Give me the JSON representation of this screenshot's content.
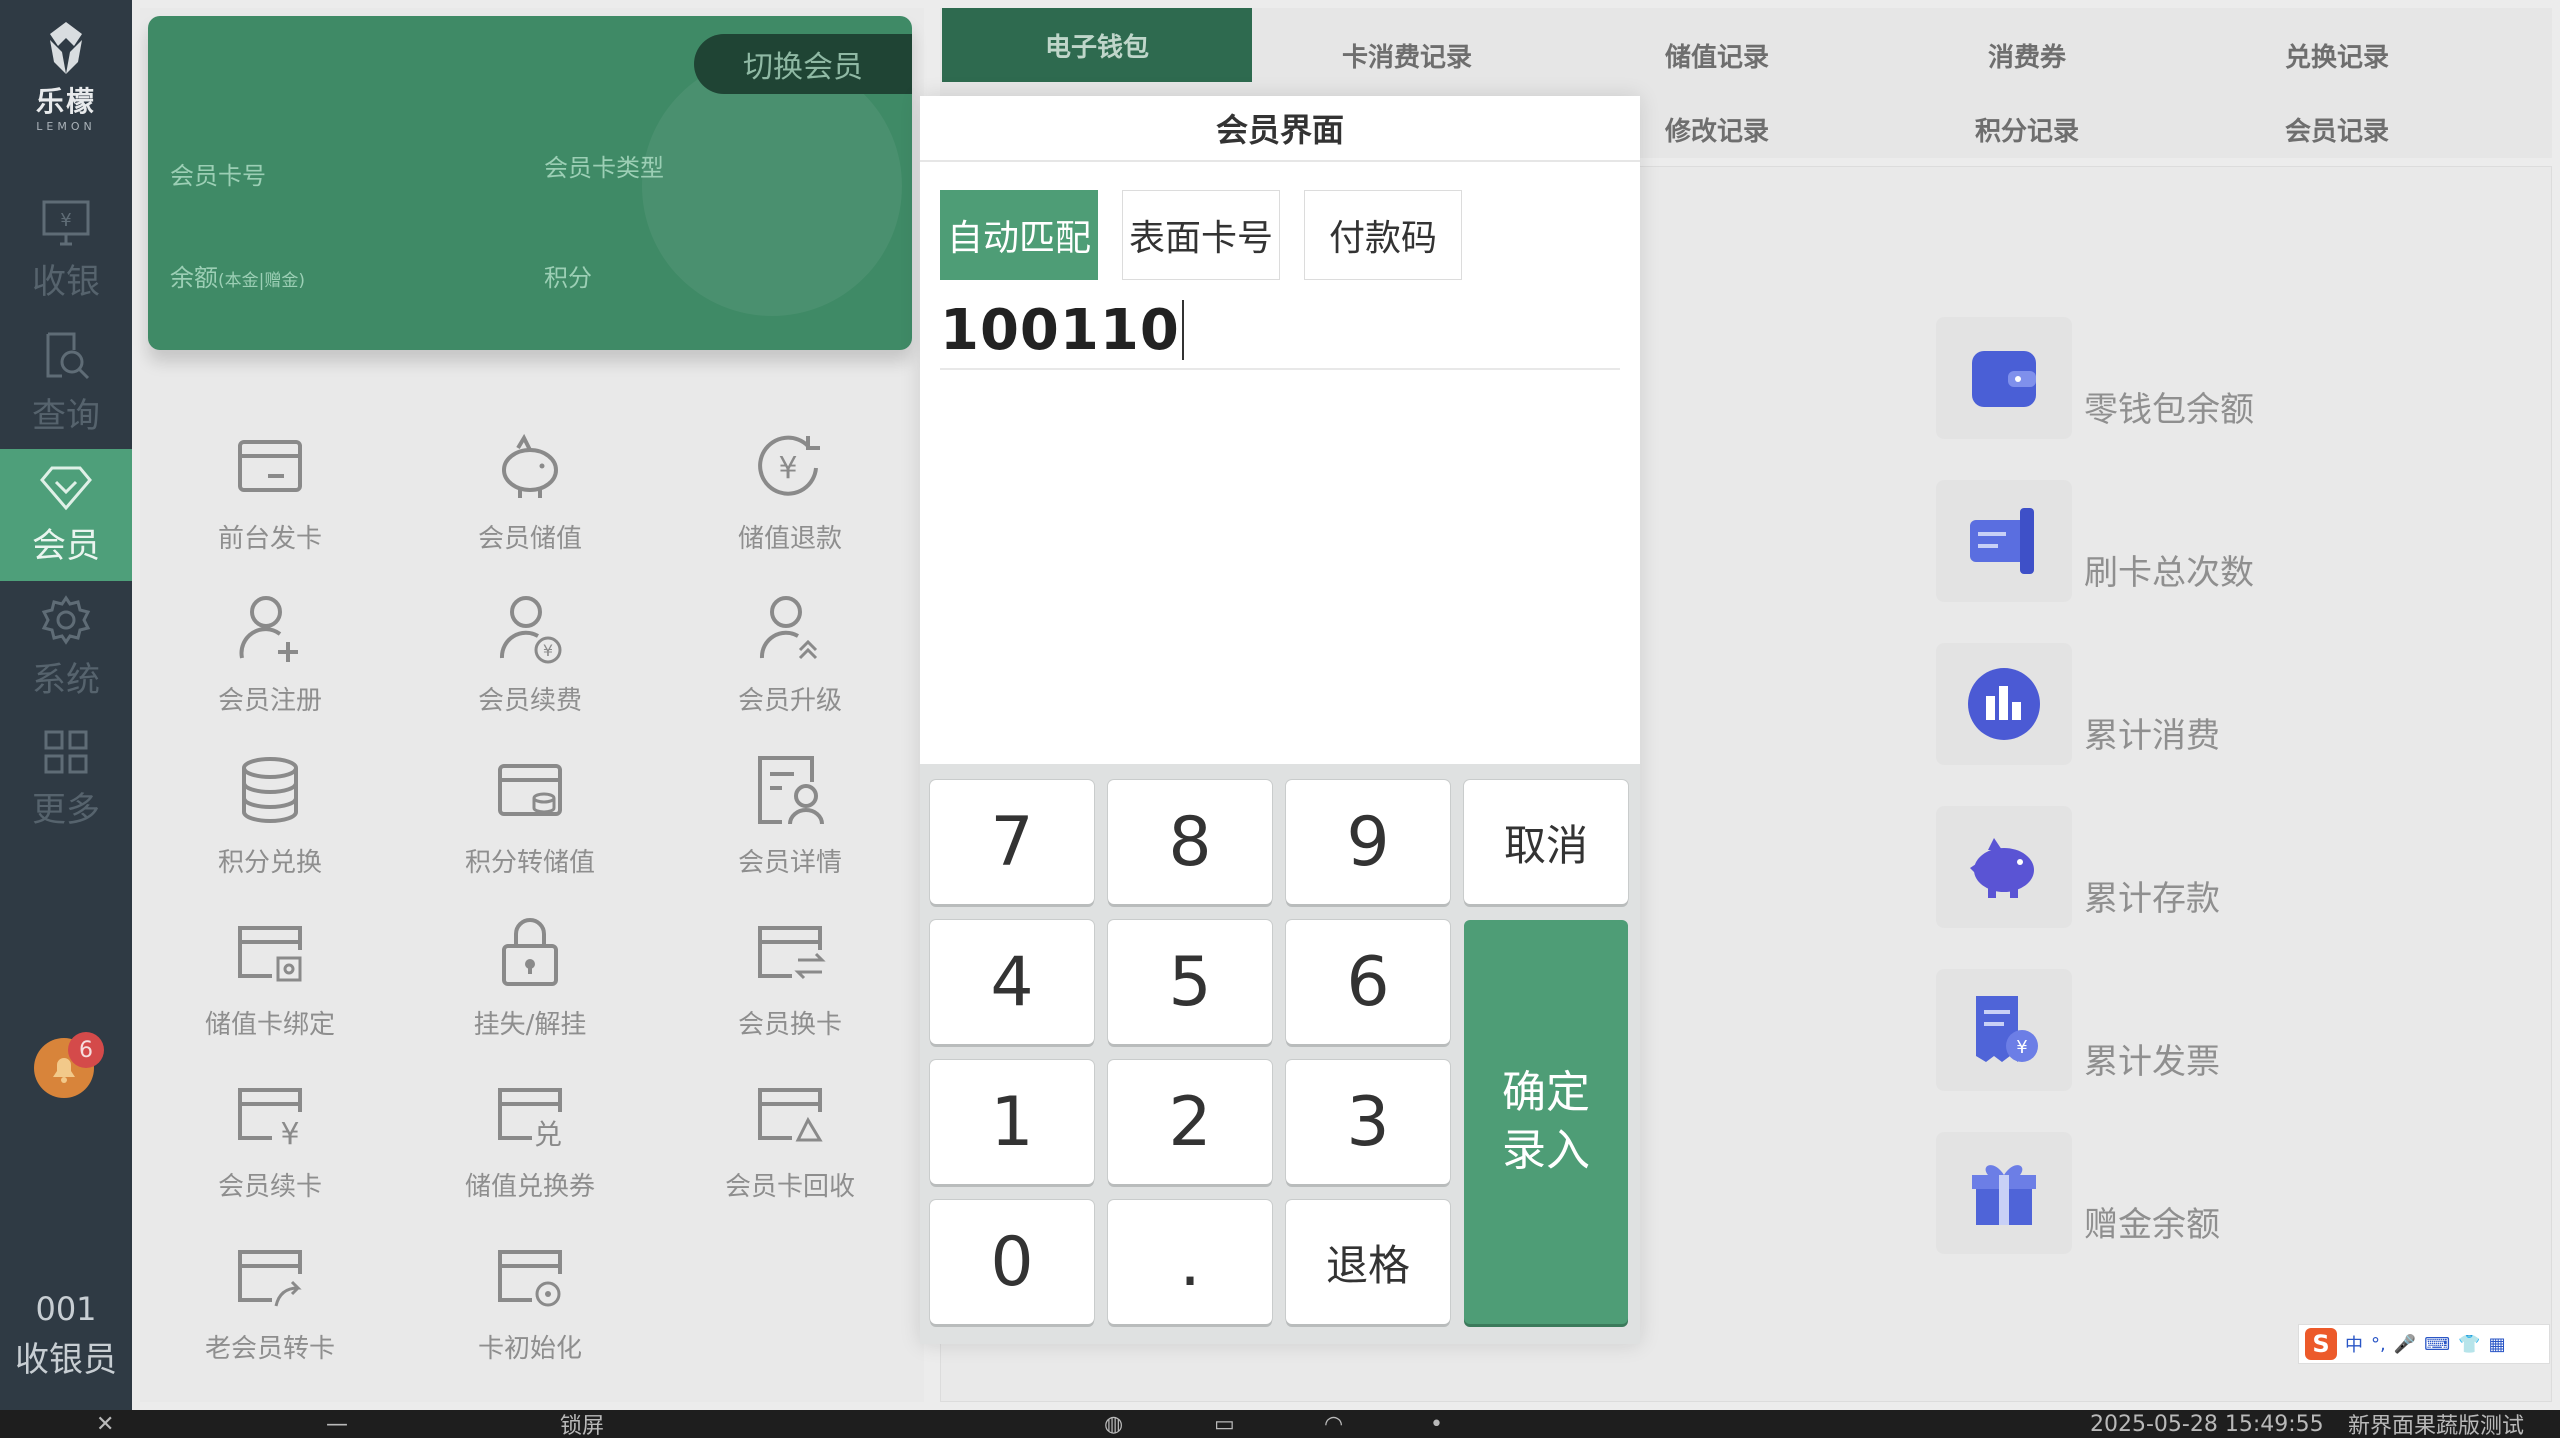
{
  "nav": {
    "logo_cn": "乐檬",
    "logo_en": "LEMON",
    "items": [
      {
        "label": "收银",
        "icon": "cash-register-icon"
      },
      {
        "label": "查询",
        "icon": "search-document-icon"
      },
      {
        "label": "会员",
        "icon": "diamond-icon"
      },
      {
        "label": "系统",
        "icon": "gear-icon"
      },
      {
        "label": "更多",
        "icon": "grid-icon"
      }
    ],
    "active": "会员",
    "bell_badge": "6",
    "cashier_id": "001",
    "cashier_role": "收银员"
  },
  "member_card": {
    "switch_label": "切换会员",
    "card_no_label": "会员卡号",
    "card_type_label": "会员卡类型",
    "balance_label": "余额",
    "balance_sub": "(本金|赠金)",
    "points_label": "积分"
  },
  "functions": [
    {
      "label": "前台发卡",
      "icon": "card-icon"
    },
    {
      "label": "会员储值",
      "icon": "piggy-bank-icon"
    },
    {
      "label": "储值退款",
      "icon": "yen-refund-icon"
    },
    {
      "label": "会员注册",
      "icon": "user-add-icon"
    },
    {
      "label": "会员续费",
      "icon": "user-yen-icon"
    },
    {
      "label": "会员升级",
      "icon": "user-upgrade-icon"
    },
    {
      "label": "积分兑换",
      "icon": "database-icon"
    },
    {
      "label": "积分转储值",
      "icon": "card-stack-icon"
    },
    {
      "label": "会员详情",
      "icon": "user-detail-icon"
    },
    {
      "label": "储值卡绑定",
      "icon": "card-bind-icon"
    },
    {
      "label": "挂失/解挂",
      "icon": "lock-icon"
    },
    {
      "label": "会员换卡",
      "icon": "card-swap-icon"
    },
    {
      "label": "会员续卡",
      "icon": "card-yen-icon"
    },
    {
      "label": "储值兑换券",
      "icon": "card-exchange-icon"
    },
    {
      "label": "会员卡回收",
      "icon": "card-recycle-icon"
    },
    {
      "label": "老会员转卡",
      "icon": "card-transfer-icon"
    },
    {
      "label": "卡初始化",
      "icon": "card-init-icon"
    }
  ],
  "tabs": [
    {
      "label": "电子钱包"
    },
    {
      "label": "卡消费记录"
    },
    {
      "label": "储值记录"
    },
    {
      "label": "消费券"
    },
    {
      "label": "兑换记录"
    },
    {
      "label": "修改记录"
    },
    {
      "label": "积分记录"
    },
    {
      "label": "会员记录"
    }
  ],
  "active_tab": "电子钱包",
  "stats": [
    {
      "label": "零钱包余额",
      "icon": "wallet-icon",
      "color": "#4a5fd6"
    },
    {
      "label": "刷卡总次数",
      "icon": "card-swipe-icon",
      "color": "#5a6ee0"
    },
    {
      "label": "累计消费",
      "icon": "bar-chart-icon",
      "color": "#4b5ad4"
    },
    {
      "label": "累计存款",
      "icon": "piggy-bank-icon",
      "color": "#5a54d4"
    },
    {
      "label": "累计发票",
      "icon": "invoice-icon",
      "color": "#4f64d8"
    },
    {
      "label": "赠金余额",
      "icon": "gift-icon",
      "color": "#4f64d8"
    }
  ],
  "modal": {
    "title": "会员界面",
    "modes": [
      {
        "label": "自动匹配"
      },
      {
        "label": "表面卡号"
      },
      {
        "label": "付款码"
      }
    ],
    "active_mode": "自动匹配",
    "input_value": "100110",
    "keys": {
      "k7": "7",
      "k8": "8",
      "k9": "9",
      "cancel": "取消",
      "k4": "4",
      "k5": "5",
      "k6": "6",
      "k1": "1",
      "k2": "2",
      "k3": "3",
      "k0": "0",
      "dot": ".",
      "backspace": "退格",
      "confirm": "确定\n录入"
    }
  },
  "ime": {
    "logo": "S",
    "lang": "中",
    "punct": "°,"
  },
  "taskbar": {
    "lock": "锁屏",
    "datetime": "2025-05-28 15:49:55",
    "app_name": "新界面果蔬版测试"
  },
  "colors": {
    "primary_green": "#4e9d76",
    "nav_bg": "#2f3a44",
    "tab_active": "#2e6a4f"
  }
}
